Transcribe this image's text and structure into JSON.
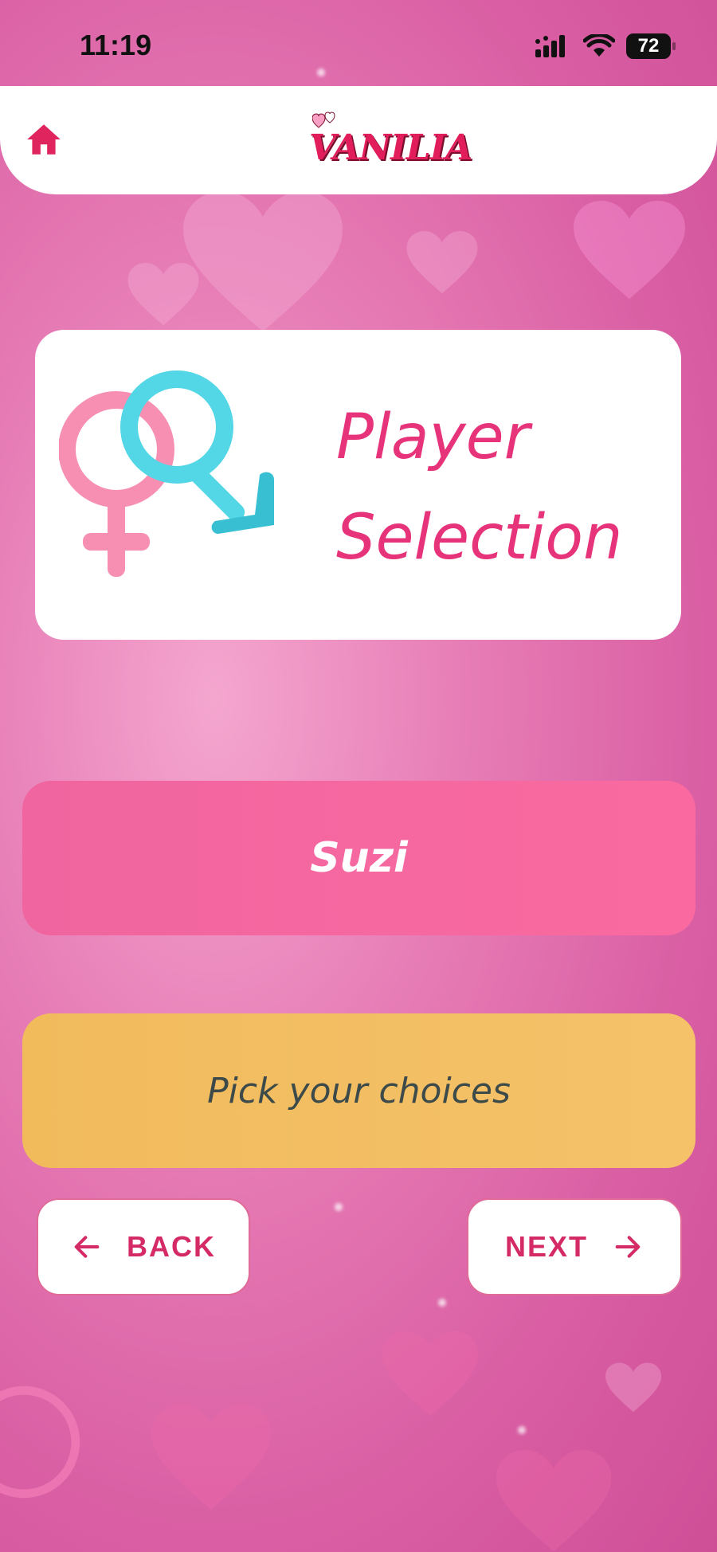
{
  "status_bar": {
    "time": "11:19",
    "battery": "72"
  },
  "header": {
    "logo_text": "VANILIA"
  },
  "title_card": {
    "title_line1": "Player",
    "title_line2": "Selection"
  },
  "player": {
    "name": "Suzi"
  },
  "choices": {
    "label": "Pick your choices"
  },
  "nav": {
    "back_label": "BACK",
    "next_label": "NEXT"
  },
  "colors": {
    "accent": "#e6337a",
    "player_button": "#f56aa0",
    "choices_button": "#f3bf63",
    "nav_text": "#d42a66"
  },
  "icons": {
    "home": "home-icon",
    "gender": "gender-symbols-icon",
    "back": "arrow-left-icon",
    "next": "arrow-right-icon"
  }
}
